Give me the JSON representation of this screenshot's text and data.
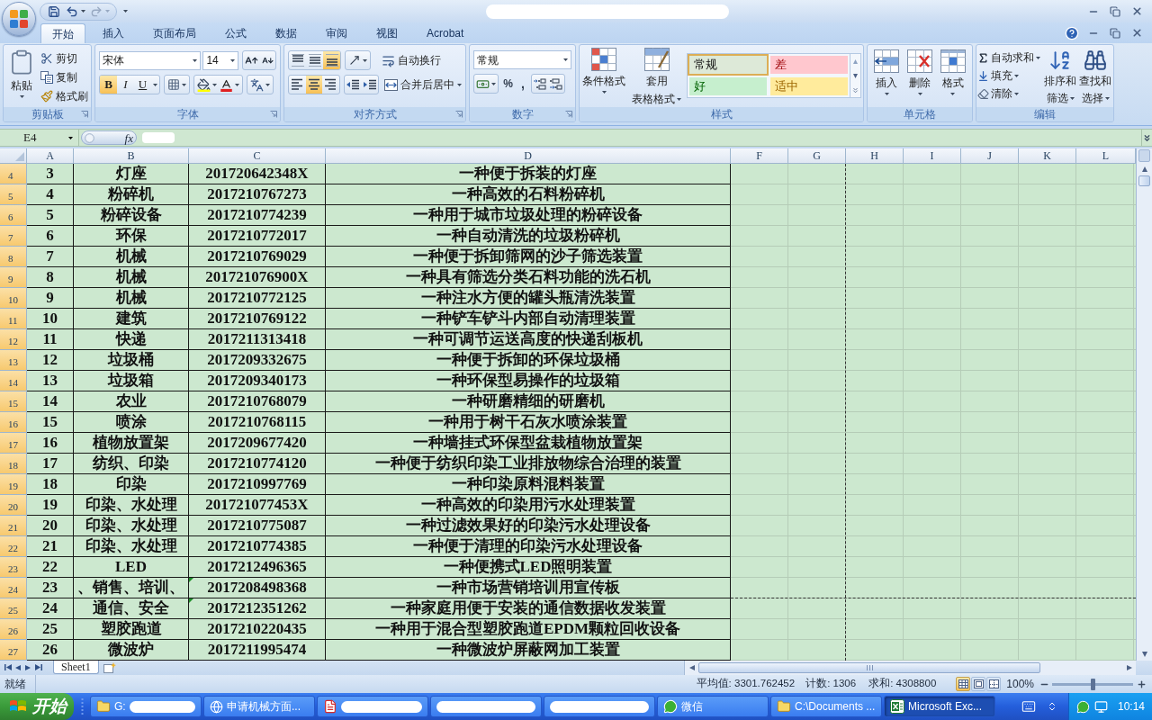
{
  "title_bar": {
    "redacted": true
  },
  "tabs": [
    {
      "label": "开始",
      "selected": true
    },
    {
      "label": "插入",
      "selected": false
    },
    {
      "label": "页面布局",
      "selected": false
    },
    {
      "label": "公式",
      "selected": false
    },
    {
      "label": "数据",
      "selected": false
    },
    {
      "label": "审阅",
      "selected": false
    },
    {
      "label": "视图",
      "selected": false
    },
    {
      "label": "Acrobat",
      "selected": false
    }
  ],
  "ribbon": {
    "clipboard": {
      "label": "剪贴板",
      "paste": "粘贴",
      "cut": "剪切",
      "copy": "复制",
      "format_painter": "格式刷"
    },
    "font": {
      "label": "字体",
      "font_name": "宋体",
      "font_size": "14",
      "styles": [
        {
          "kind": "bold",
          "label": "B",
          "on": true
        },
        {
          "kind": "italic",
          "label": "I",
          "on": false
        },
        {
          "kind": "underline",
          "label": "U",
          "on": false
        }
      ]
    },
    "alignment": {
      "label": "对齐方式",
      "vertical": [
        {
          "kind": "top",
          "selected": false
        },
        {
          "kind": "middle",
          "selected": false
        },
        {
          "kind": "bottom",
          "selected": true
        }
      ],
      "horizontal": [
        {
          "kind": "left",
          "selected": false
        },
        {
          "kind": "center",
          "selected": true
        },
        {
          "kind": "right",
          "selected": false
        }
      ],
      "wrap_text": "自动换行",
      "merge_center": "合并后居中"
    },
    "number": {
      "label": "数字",
      "format": "常规",
      "percent": "%",
      "comma": ","
    },
    "styles": {
      "label": "样式",
      "conditional_formatting": "条件格式",
      "table_format": [
        "套用",
        "表格格式"
      ],
      "gallery": [
        {
          "kind": "normal",
          "label": "常规",
          "selected": true
        },
        {
          "kind": "bad",
          "label": "差",
          "selected": false
        },
        {
          "kind": "good",
          "label": "好",
          "selected": false
        },
        {
          "kind": "neutral",
          "label": "适中",
          "selected": false
        }
      ]
    },
    "cells": {
      "label": "单元格",
      "buttons": [
        {
          "kind": "insert",
          "label": "插入"
        },
        {
          "kind": "delete",
          "label": "删除"
        },
        {
          "kind": "format",
          "label": "格式"
        }
      ]
    },
    "editing": {
      "label": "编辑",
      "autosum": "自动求和",
      "fill": "填充",
      "clear": "清除",
      "sort_filter": [
        "排序和",
        "筛选"
      ],
      "find_select": [
        "查找和",
        "选择"
      ]
    }
  },
  "formula_bar": {
    "name_box": "E4",
    "fx": "fx",
    "redacted": true
  },
  "sheet": {
    "columns": [
      "A",
      "B",
      "C",
      "D",
      "F",
      "G",
      "H",
      "I",
      "J",
      "K",
      "L"
    ],
    "rows": [
      {
        "number": "4",
        "selected": true,
        "flag": false,
        "page_break": false,
        "cells": [
          "3",
          "灯座",
          "201720642348X",
          "一种便于拆装的灯座"
        ]
      },
      {
        "number": "5",
        "selected": true,
        "flag": false,
        "page_break": false,
        "cells": [
          "4",
          "粉碎机",
          "2017210767273",
          "一种高效的石料粉碎机"
        ]
      },
      {
        "number": "6",
        "selected": true,
        "flag": false,
        "page_break": false,
        "cells": [
          "5",
          "粉碎设备",
          "2017210774239",
          "一种用于城市垃圾处理的粉碎设备"
        ]
      },
      {
        "number": "7",
        "selected": true,
        "flag": false,
        "page_break": false,
        "cells": [
          "6",
          "环保",
          "2017210772017",
          "一种自动清洗的垃圾粉碎机"
        ]
      },
      {
        "number": "8",
        "selected": true,
        "flag": false,
        "page_break": false,
        "cells": [
          "7",
          "机械",
          "2017210769029",
          "一种便于拆卸筛网的沙子筛选装置"
        ]
      },
      {
        "number": "9",
        "selected": true,
        "flag": false,
        "page_break": false,
        "cells": [
          "8",
          "机械",
          "201721076900X",
          "一种具有筛选分类石料功能的洗石机"
        ]
      },
      {
        "number": "10",
        "selected": true,
        "flag": false,
        "page_break": false,
        "cells": [
          "9",
          "机械",
          "2017210772125",
          "一种注水方便的罐头瓶清洗装置"
        ]
      },
      {
        "number": "11",
        "selected": true,
        "flag": false,
        "page_break": false,
        "cells": [
          "10",
          "建筑",
          "2017210769122",
          "一种铲车铲斗内部自动清理装置"
        ]
      },
      {
        "number": "12",
        "selected": true,
        "flag": false,
        "page_break": false,
        "cells": [
          "11",
          "快递",
          "2017211313418",
          "一种可调节运送高度的快递刮板机"
        ]
      },
      {
        "number": "13",
        "selected": true,
        "flag": false,
        "page_break": false,
        "cells": [
          "12",
          "垃圾桶",
          "2017209332675",
          "一种便于拆卸的环保垃圾桶"
        ]
      },
      {
        "number": "14",
        "selected": true,
        "flag": false,
        "page_break": false,
        "cells": [
          "13",
          "垃圾箱",
          "2017209340173",
          "一种环保型易操作的垃圾箱"
        ]
      },
      {
        "number": "15",
        "selected": true,
        "flag": false,
        "page_break": false,
        "cells": [
          "14",
          "农业",
          "2017210768079",
          "一种研磨精细的研磨机"
        ]
      },
      {
        "number": "16",
        "selected": true,
        "flag": false,
        "page_break": false,
        "cells": [
          "15",
          "喷涂",
          "2017210768115",
          "一种用于树干石灰水喷涂装置"
        ]
      },
      {
        "number": "17",
        "selected": true,
        "flag": false,
        "page_break": false,
        "cells": [
          "16",
          "植物放置架",
          "2017209677420",
          "一种墙挂式环保型盆栽植物放置架"
        ]
      },
      {
        "number": "18",
        "selected": true,
        "flag": false,
        "page_break": false,
        "cells": [
          "17",
          "纺织、印染",
          "2017210774120",
          "一种便于纺织印染工业排放物综合治理的装置"
        ]
      },
      {
        "number": "19",
        "selected": true,
        "flag": false,
        "page_break": false,
        "cells": [
          "18",
          "印染",
          "2017210997769",
          "一种印染原料混料装置"
        ]
      },
      {
        "number": "20",
        "selected": true,
        "flag": false,
        "page_break": false,
        "cells": [
          "19",
          "印染、水处理",
          "201721077453X",
          "一种高效的印染用污水处理装置"
        ]
      },
      {
        "number": "21",
        "selected": true,
        "flag": false,
        "page_break": false,
        "cells": [
          "20",
          "印染、水处理",
          "2017210775087",
          "一种过滤效果好的印染污水处理设备"
        ]
      },
      {
        "number": "22",
        "selected": true,
        "flag": false,
        "page_break": false,
        "cells": [
          "21",
          "印染、水处理",
          "2017210774385",
          "一种便于清理的印染污水处理设备"
        ]
      },
      {
        "number": "23",
        "selected": true,
        "flag": false,
        "page_break": false,
        "cells": [
          "22",
          "LED",
          "2017212496365",
          "一种便携式LED照明装置"
        ]
      },
      {
        "number": "24",
        "selected": true,
        "flag": true,
        "page_break": true,
        "cells": [
          "23",
          "、销售、培训、",
          "2017208498368",
          "一种市场营销培训用宣传板"
        ]
      },
      {
        "number": "25",
        "selected": true,
        "flag": true,
        "page_break": false,
        "cells": [
          "24",
          "通信、安全",
          "2017212351262",
          "一种家庭用便于安装的通信数据收发装置"
        ]
      },
      {
        "number": "26",
        "selected": true,
        "flag": false,
        "page_break": false,
        "cells": [
          "25",
          "塑胶跑道",
          "2017210220435",
          "一种用于混合型塑胶跑道EPDM颗粒回收设备"
        ]
      },
      {
        "number": "27",
        "selected": true,
        "flag": false,
        "page_break": false,
        "cells": [
          "26",
          "微波炉",
          "2017211995474",
          "一种微波炉屏蔽网加工装置"
        ]
      }
    ]
  },
  "sheet_tabs": [
    {
      "label": "Sheet1",
      "selected": true
    }
  ],
  "status_bar": {
    "status": "就绪",
    "average": "平均值: 3301.762452",
    "count": "计数: 1306",
    "sum": "求和: 4308800",
    "views": [
      {
        "kind": "normal",
        "selected": true
      },
      {
        "kind": "page_layout",
        "selected": false
      },
      {
        "kind": "page_break",
        "selected": false
      }
    ],
    "zoom": "100%",
    "zoom_slider": {
      "level": 0.5
    }
  },
  "taskbar": {
    "start": "开始",
    "items": [
      {
        "kind": "folder",
        "label": "G:",
        "redacted": true,
        "selected": false
      },
      {
        "kind": "globe",
        "label": "申请机械方面...",
        "redacted": false,
        "selected": false
      },
      {
        "kind": "pdf",
        "redacted": true,
        "selected": false
      },
      {
        "kind": "none",
        "redacted": true,
        "selected": false
      },
      {
        "kind": "none",
        "redacted": true,
        "selected": false
      },
      {
        "kind": "wechat",
        "label": "微信",
        "redacted": false,
        "selected": false
      },
      {
        "kind": "folder",
        "label": "C:\\Documents ...",
        "redacted": false,
        "selected": false
      },
      {
        "kind": "excel",
        "label": "Microsoft Exc...",
        "redacted": false,
        "selected": true
      }
    ],
    "clock": "10:14"
  }
}
